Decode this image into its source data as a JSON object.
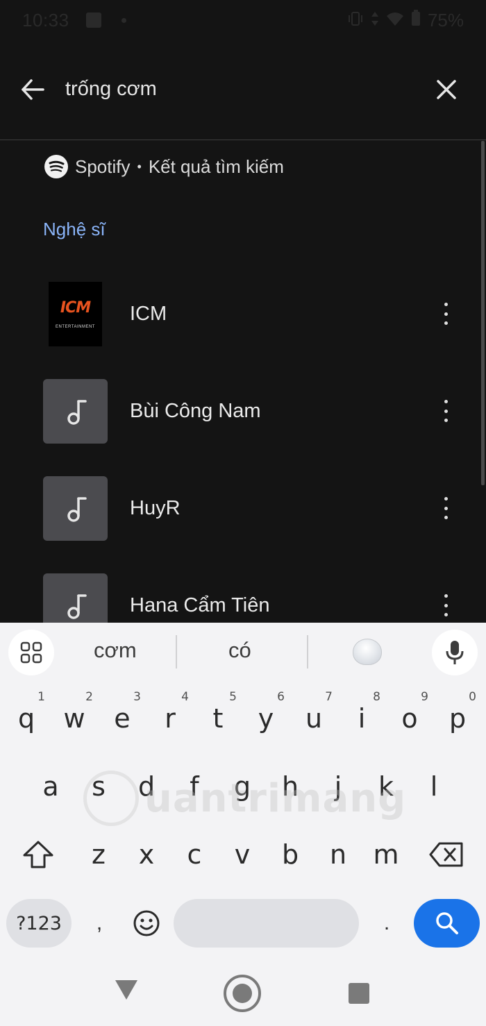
{
  "status_bar": {
    "time": "10:33",
    "battery": "75%"
  },
  "search": {
    "query": "trống cơm"
  },
  "results": {
    "source_label": "Spotify",
    "source_separator": "•",
    "source_subtitle": "Kết quả tìm kiếm",
    "section_title": "Nghệ sĩ",
    "artists": [
      {
        "name": "ICM",
        "thumb": "icm-logo",
        "logo_text": "ICM",
        "logo_sub": "ENTERTAINMENT"
      },
      {
        "name": "Bùi Công Nam",
        "thumb": "music-note-icon"
      },
      {
        "name": "HuyR",
        "thumb": "music-note-icon"
      },
      {
        "name": "Hana Cẩm Tiên",
        "thumb": "music-note-icon"
      }
    ]
  },
  "keyboard": {
    "suggestions": [
      "cơm",
      "có"
    ],
    "row1": [
      {
        "key": "q",
        "hint": "1"
      },
      {
        "key": "w",
        "hint": "2"
      },
      {
        "key": "e",
        "hint": "3"
      },
      {
        "key": "r",
        "hint": "4"
      },
      {
        "key": "t",
        "hint": "5"
      },
      {
        "key": "y",
        "hint": "6"
      },
      {
        "key": "u",
        "hint": "7"
      },
      {
        "key": "i",
        "hint": "8"
      },
      {
        "key": "o",
        "hint": "9"
      },
      {
        "key": "p",
        "hint": "0"
      }
    ],
    "row2": [
      "a",
      "s",
      "d",
      "f",
      "g",
      "h",
      "j",
      "k",
      "l"
    ],
    "row3": [
      "z",
      "x",
      "c",
      "v",
      "b",
      "n",
      "m"
    ],
    "symbols_label": "?123",
    "comma": ",",
    "period": ".",
    "accent_color": "#1a73e8"
  },
  "watermark": {
    "text": "uantrimang"
  }
}
